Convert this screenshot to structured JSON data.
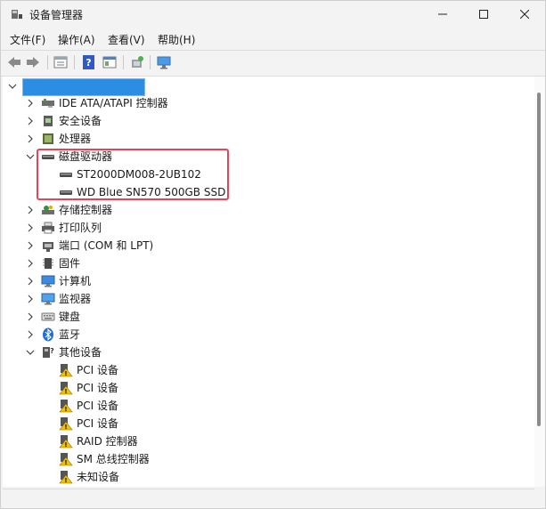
{
  "window": {
    "title": "设备管理器"
  },
  "menu": [
    "文件(F)",
    "操作(A)",
    "查看(V)",
    "帮助(H)"
  ],
  "tree": {
    "root_label": "",
    "categories": [
      {
        "label": "IDE ATA/ATAPI 控制器",
        "icon": "ide-controller-icon",
        "expanded": false
      },
      {
        "label": "安全设备",
        "icon": "security-device-icon",
        "expanded": false
      },
      {
        "label": "处理器",
        "icon": "processor-icon",
        "expanded": false
      },
      {
        "label": "磁盘驱动器",
        "icon": "disk-drive-icon",
        "expanded": true
      },
      {
        "label": "存储控制器",
        "icon": "storage-controller-icon",
        "expanded": false
      },
      {
        "label": "打印队列",
        "icon": "printer-icon",
        "expanded": false
      },
      {
        "label": "端口 (COM 和 LPT)",
        "icon": "port-icon",
        "expanded": false
      },
      {
        "label": "固件",
        "icon": "firmware-icon",
        "expanded": false
      },
      {
        "label": "计算机",
        "icon": "computer-icon",
        "expanded": false
      },
      {
        "label": "监视器",
        "icon": "monitor-icon",
        "expanded": false
      },
      {
        "label": "键盘",
        "icon": "keyboard-icon",
        "expanded": false
      },
      {
        "label": "蓝牙",
        "icon": "bluetooth-icon",
        "expanded": false
      },
      {
        "label": "其他设备",
        "icon": "other-devices-icon",
        "expanded": true
      }
    ],
    "disk_drives": [
      "ST2000DM008-2UB102",
      "WD Blue SN570 500GB SSD"
    ],
    "other_devices": [
      "PCI 设备",
      "PCI 设备",
      "PCI 设备",
      "PCI 设备",
      "RAID 控制器",
      "SM 总线控制器",
      "未知设备"
    ]
  },
  "colors": {
    "selection": "#2b8de3",
    "highlight_border": "#e0455c",
    "warning": "#f2c200"
  }
}
